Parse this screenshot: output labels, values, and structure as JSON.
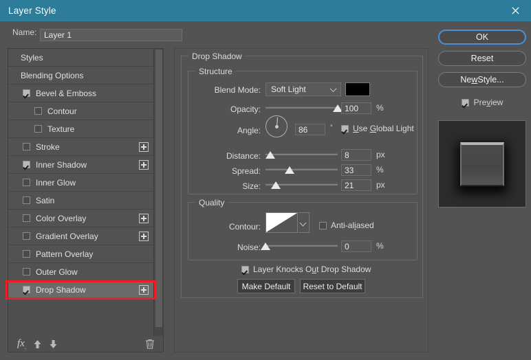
{
  "window": {
    "title": "Layer Style",
    "close_icon": "close-icon"
  },
  "name_field": {
    "label": "Name:",
    "value": "Layer 1"
  },
  "styles_panel": {
    "items": [
      {
        "label": "Styles",
        "checkbox": "none",
        "indent": 0,
        "plus": false,
        "selected": false
      },
      {
        "label": "Blending Options",
        "checkbox": "none",
        "indent": 0,
        "plus": false,
        "selected": false
      },
      {
        "label": "Bevel & Emboss",
        "checkbox": "checked",
        "indent": 0,
        "plus": false,
        "selected": false
      },
      {
        "label": "Contour",
        "checkbox": "unchecked",
        "indent": 1,
        "plus": false,
        "selected": false
      },
      {
        "label": "Texture",
        "checkbox": "unchecked",
        "indent": 1,
        "plus": false,
        "selected": false
      },
      {
        "label": "Stroke",
        "checkbox": "unchecked",
        "indent": 0,
        "plus": true,
        "selected": false
      },
      {
        "label": "Inner Shadow",
        "checkbox": "checked",
        "indent": 0,
        "plus": true,
        "selected": false
      },
      {
        "label": "Inner Glow",
        "checkbox": "unchecked",
        "indent": 0,
        "plus": false,
        "selected": false
      },
      {
        "label": "Satin",
        "checkbox": "unchecked",
        "indent": 0,
        "plus": false,
        "selected": false
      },
      {
        "label": "Color Overlay",
        "checkbox": "unchecked",
        "indent": 0,
        "plus": true,
        "selected": false
      },
      {
        "label": "Gradient Overlay",
        "checkbox": "unchecked",
        "indent": 0,
        "plus": true,
        "selected": false
      },
      {
        "label": "Pattern Overlay",
        "checkbox": "unchecked",
        "indent": 0,
        "plus": false,
        "selected": false
      },
      {
        "label": "Outer Glow",
        "checkbox": "unchecked",
        "indent": 0,
        "plus": false,
        "selected": false
      },
      {
        "label": "Drop Shadow",
        "checkbox": "checked",
        "indent": 0,
        "plus": true,
        "selected": true
      }
    ],
    "toolbar": {
      "fx_icon": "fx-icon",
      "move_up_icon": "arrow-up-icon",
      "move_down_icon": "arrow-down-icon",
      "delete_icon": "trash-icon"
    }
  },
  "drop_shadow": {
    "group_label": "Drop Shadow",
    "structure": {
      "group_label": "Structure",
      "blend_mode": {
        "label": "Blend Mode:",
        "value": "Soft Light"
      },
      "color": {
        "hex": "#000000"
      },
      "opacity": {
        "label": "Opacity:",
        "value": "100",
        "unit": "%",
        "percent": 100
      },
      "angle": {
        "label": "Angle:",
        "value": "86",
        "unit": "°",
        "degrees": 86
      },
      "use_global_light": {
        "label": "Use Global Light",
        "checked": true
      },
      "distance": {
        "label": "Distance:",
        "value": "8",
        "unit": "px",
        "percent": 7
      },
      "spread": {
        "label": "Spread:",
        "value": "33",
        "unit": "%",
        "percent": 33
      },
      "size": {
        "label": "Size:",
        "value": "21",
        "unit": "px",
        "percent": 14
      }
    },
    "quality": {
      "group_label": "Quality",
      "contour": {
        "label": "Contour:"
      },
      "anti_aliased": {
        "label": "Anti-aliased",
        "checked": false
      },
      "noise": {
        "label": "Noise:",
        "value": "0",
        "unit": "%",
        "percent": 0
      }
    },
    "layer_knocks_out": {
      "label": "Layer Knocks Out Drop Shadow",
      "checked": true
    },
    "make_default_button": "Make Default",
    "reset_to_default_button": "Reset to Default"
  },
  "actions": {
    "ok": "OK",
    "reset": "Reset",
    "new_style": "New Style...",
    "preview": {
      "label": "Preview",
      "checked": true
    }
  },
  "colors": {
    "titlebar": "#2d7d9a",
    "highlight_red": "#ee1c24",
    "focus_blue": "#4a90d9",
    "dialog_bg": "#535353"
  }
}
